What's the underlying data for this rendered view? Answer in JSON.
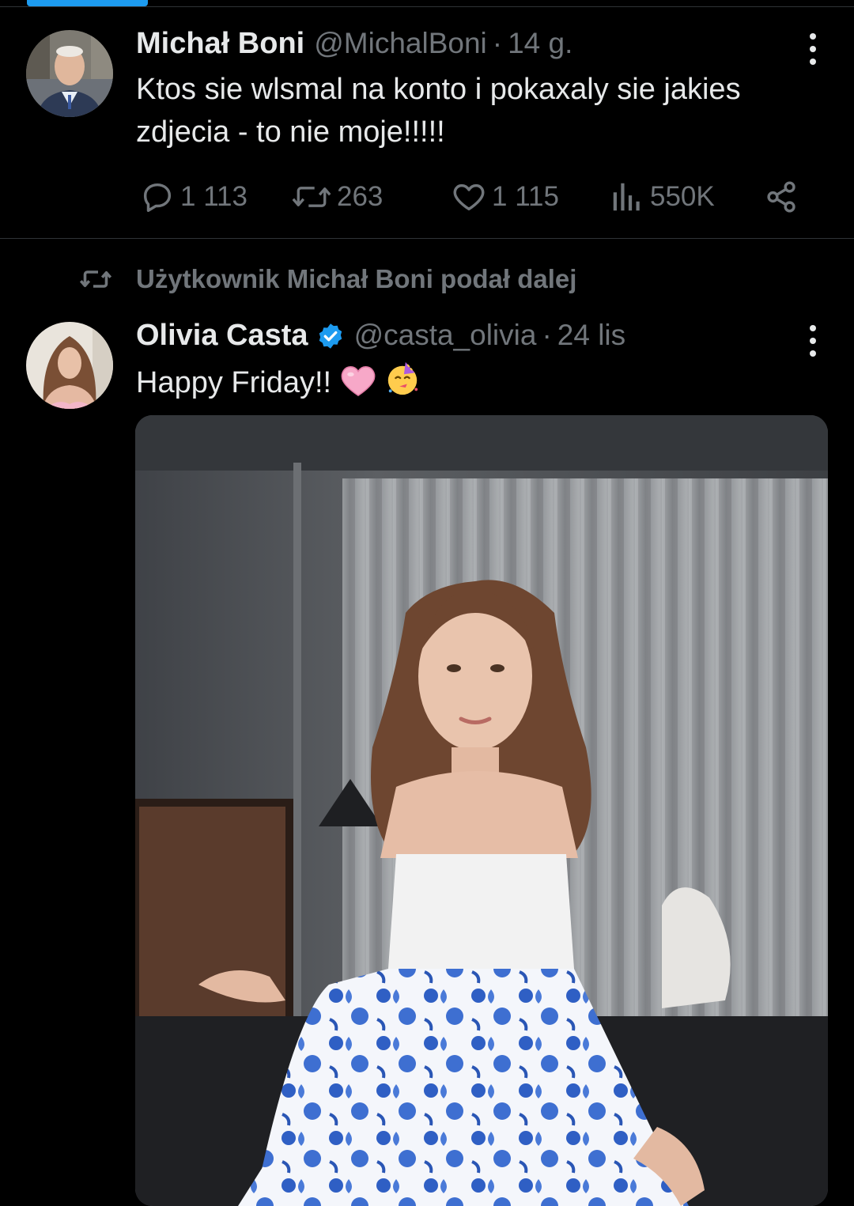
{
  "tweet1": {
    "author_name": "Michał Boni",
    "author_handle": "@MichalBoni",
    "separator": "·",
    "time": "14 g.",
    "text": "Ktos sie wlsmal na konto i pokaxaly sie jakies zdjecia - to nie moje!!!!!",
    "actions": {
      "replies": "1 113",
      "retweets": "263",
      "likes": "1 115",
      "views": "550K"
    }
  },
  "repost_banner": "Użytkownik Michał Boni podał dalej",
  "tweet2": {
    "author_name": "Olivia Casta",
    "author_handle": "@casta_olivia",
    "separator": "·",
    "time": "24 lis",
    "text": "Happy Friday!!",
    "verified": true
  },
  "colors": {
    "background": "#000000",
    "text": "#e7e9ea",
    "secondary_text": "#71767b",
    "accent": "#1d9bf0",
    "divider": "#2f3336"
  },
  "icons": {
    "reply": "speech-bubble-icon",
    "retweet": "retweet-arrows-icon",
    "like": "heart-outline-icon",
    "views": "bar-chart-icon",
    "share": "share-nodes-icon",
    "more": "vertical-ellipsis-icon",
    "verified": "blue-check-badge-icon"
  }
}
